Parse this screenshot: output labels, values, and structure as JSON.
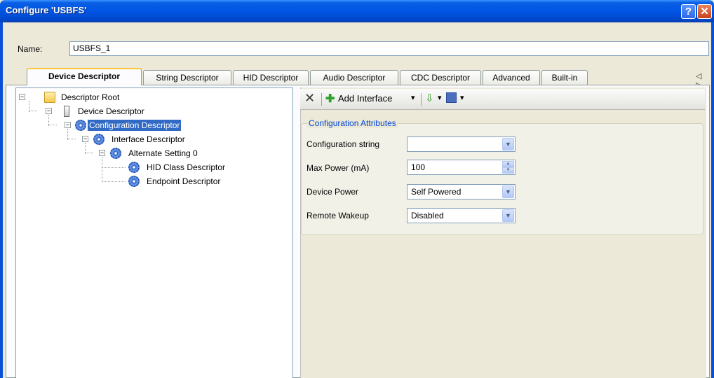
{
  "window": {
    "title": "Configure 'USBFS'",
    "help_glyph": "?",
    "close_glyph": "✕"
  },
  "name_row": {
    "label": "Name:",
    "value": "USBFS_1"
  },
  "tabs": [
    {
      "label": "Device Descriptor",
      "active": true
    },
    {
      "label": "String Descriptor",
      "active": false
    },
    {
      "label": "HID Descriptor",
      "active": false
    },
    {
      "label": "Audio Descriptor",
      "active": false
    },
    {
      "label": "CDC Descriptor",
      "active": false
    },
    {
      "label": "Advanced",
      "active": false
    },
    {
      "label": "Built-in",
      "active": false
    }
  ],
  "tab_scroll_arrows": "◁ ▷",
  "tree": {
    "items": [
      {
        "label": "Descriptor Root",
        "icon": "folder-icon",
        "expanded": true
      },
      {
        "label": "Device Descriptor",
        "icon": "usb-device-icon",
        "expanded": true
      },
      {
        "label": "Configuration Descriptor",
        "icon": "gear-icon",
        "expanded": true,
        "selected": true
      },
      {
        "label": "Interface Descriptor",
        "icon": "gear-icon",
        "expanded": true
      },
      {
        "label": "Alternate Setting 0",
        "icon": "gear-icon",
        "expanded": true
      },
      {
        "label": "HID Class Descriptor",
        "icon": "gear-icon"
      },
      {
        "label": "Endpoint Descriptor",
        "icon": "gear-icon"
      }
    ]
  },
  "toolbar": {
    "delete_glyph": "✕",
    "add_interface_label": "Add Interface",
    "dropdown_glyph": "▾"
  },
  "config_attributes": {
    "group_title": "Configuration Attributes",
    "fields": [
      {
        "label": "Configuration string",
        "value": ""
      },
      {
        "label": "Max Power (mA)",
        "value": "100"
      },
      {
        "label": "Device Power",
        "value": "Self Powered"
      },
      {
        "label": "Remote Wakeup",
        "value": "Disabled"
      }
    ]
  },
  "colors": {
    "titlebar": "#0055e5",
    "selection": "#316ac5",
    "active_tab_accent": "#ffc73c",
    "group_title": "#0046d5"
  }
}
